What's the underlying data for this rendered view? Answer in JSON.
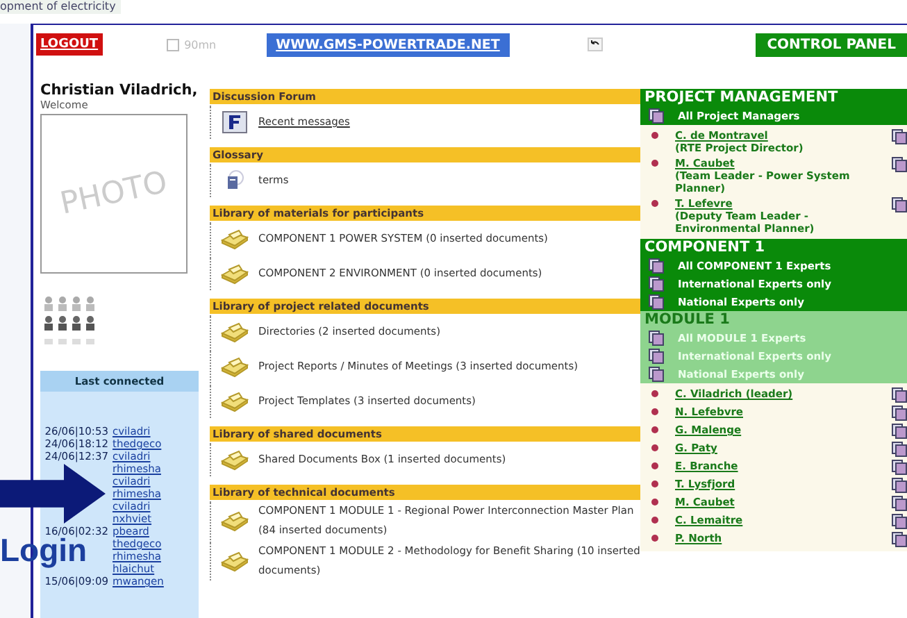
{
  "background_page": {
    "text": "opment of electricity"
  },
  "top_bar": {
    "logout": "LOGOUT",
    "timer": "90mn",
    "timer_checked": false,
    "site_link": "WWW.GMS-POWERTRADE.NET",
    "control_panel": "CONTROL PANEL"
  },
  "user": {
    "name": "Christian Viladrich,",
    "greeting": "Welcome",
    "photo": "PHOTO"
  },
  "last_connected": {
    "title": "Last connected",
    "rows": [
      {
        "time": "26/06|10:53",
        "user": "cviladri"
      },
      {
        "time": "24/06|18:12",
        "user": "thedgeco"
      },
      {
        "time": "24/06|12:37",
        "user": "cviladri"
      },
      {
        "user": "rhimesha"
      },
      {
        "user": "cviladri"
      },
      {
        "user": "rhimesha"
      },
      {
        "user": "cviladri"
      },
      {
        "user": "nxhviet"
      },
      {
        "time": "16/06|02:32",
        "user": "pbeard"
      },
      {
        "user": "thedgeco"
      },
      {
        "user": "rhimesha"
      },
      {
        "user": "hlaichut"
      },
      {
        "time": "15/06|09:09",
        "user": "mwangen"
      }
    ]
  },
  "sections": [
    {
      "title": "Discussion Forum",
      "items": [
        {
          "kind": "forum",
          "text": "Recent messages",
          "link": true
        }
      ]
    },
    {
      "title": "Glossary",
      "items": [
        {
          "kind": "glossary",
          "text": "terms",
          "link": false
        }
      ]
    },
    {
      "title": "Library of materials for participants",
      "items": [
        {
          "kind": "folder",
          "text": "COMPONENT 1 POWER SYSTEM (0 inserted documents)",
          "link": false
        },
        {
          "kind": "folder",
          "text": "COMPONENT 2 ENVIRONMENT (0 inserted documents)",
          "link": false
        }
      ]
    },
    {
      "title": "Library of project related documents",
      "items": [
        {
          "kind": "folder",
          "text": "Directories (2 inserted documents)",
          "link": false
        },
        {
          "kind": "folder",
          "text": "Project Reports / Minutes of Meetings (3 inserted documents)",
          "link": false
        },
        {
          "kind": "folder",
          "text": "Project Templates (3 inserted documents)",
          "link": false
        }
      ]
    },
    {
      "title": "Library of shared documents",
      "items": [
        {
          "kind": "folder",
          "text": "Shared Documents Box (1 inserted documents)",
          "link": false
        }
      ]
    },
    {
      "title": "Library of technical documents",
      "items": [
        {
          "kind": "folder",
          "text": "COMPONENT 1 MODULE 1 - Regional Power Interconnection Master Plan (84 inserted documents)",
          "link": false
        },
        {
          "kind": "folder",
          "text": "COMPONENT 1 MODULE 2 - Methodology for Benefit Sharing (10 inserted documents)",
          "link": false
        }
      ]
    }
  ],
  "right_panel": [
    {
      "title": "PROJECT MANAGEMENT",
      "kind": "dark",
      "rows": [
        "All Project Managers"
      ],
      "people": [
        {
          "name": "C. de Montravel",
          "role": "(RTE Project Director)"
        },
        {
          "name": "M. Caubet",
          "role": "(Team Leader - Power System Planner)"
        },
        {
          "name": "T. Lefevre",
          "role": "(Deputy Team Leader - Environmental Planner)"
        }
      ]
    },
    {
      "title": "COMPONENT 1",
      "kind": "dark",
      "rows": [
        "All COMPONENT 1 Experts",
        "International Experts only",
        "National Experts only"
      ]
    },
    {
      "title": "MODULE 1",
      "kind": "light",
      "rows": [
        "All MODULE 1 Experts",
        "International Experts only",
        "National Experts only"
      ],
      "people": [
        {
          "name": "C. Viladrich (leader)"
        },
        {
          "name": "N. Lefebvre"
        },
        {
          "name": "G. Malenge"
        },
        {
          "name": "G. Paty"
        },
        {
          "name": "E. Branche"
        },
        {
          "name": "T. Lysfjord"
        },
        {
          "name": "M. Caubet"
        },
        {
          "name": "C. Lemaitre"
        },
        {
          "name": "P. North"
        }
      ]
    }
  ],
  "overlay": {
    "label": "Login"
  }
}
